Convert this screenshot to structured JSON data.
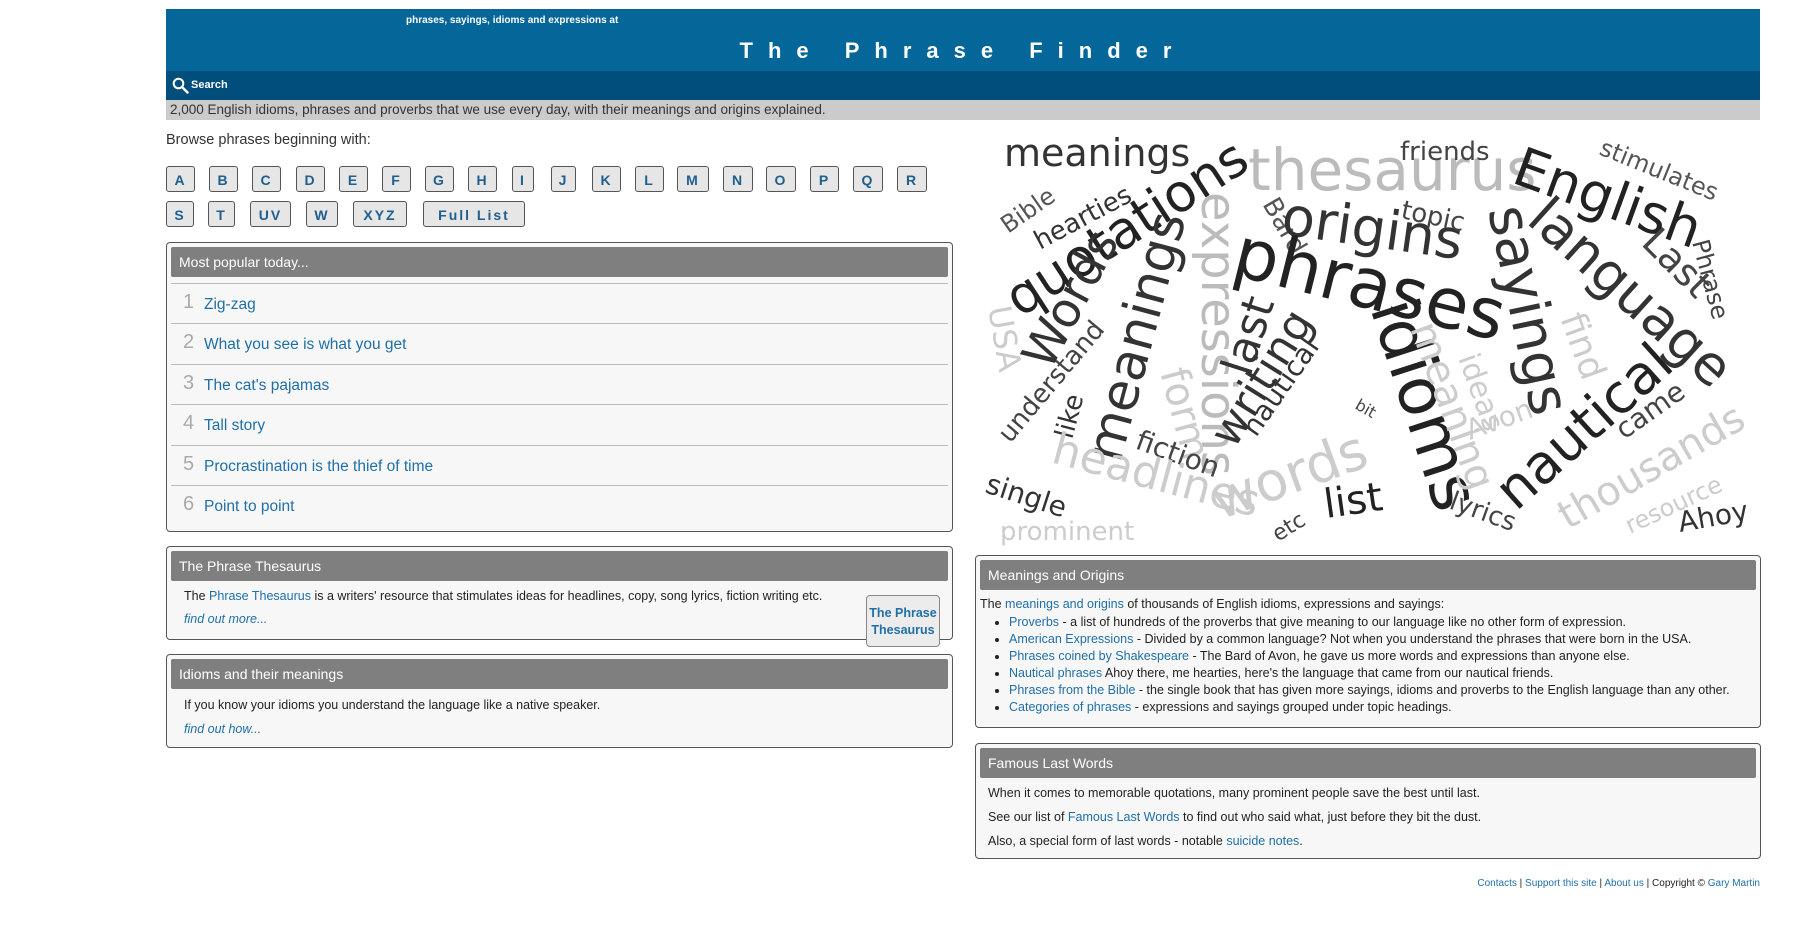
{
  "header": {
    "tagline": "phrases, sayings, idioms and expressions at",
    "title": "The Phrase Finder"
  },
  "search": {
    "label": "Search",
    "icon": "search-icon"
  },
  "intro": "2,000 English idioms, phrases and proverbs that we use every day, with their meanings and origins explained.",
  "browse": {
    "label": "Browse phrases beginning with:",
    "letters": [
      "A",
      "B",
      "C",
      "D",
      "E",
      "F",
      "G",
      "H",
      "I",
      "J",
      "K",
      "L",
      "M",
      "N",
      "O",
      "P",
      "Q",
      "R",
      "S",
      "T",
      "UV",
      "W",
      "XYZ",
      "Full List"
    ]
  },
  "popular": {
    "heading": "Most popular today...",
    "items": [
      {
        "num": "1",
        "label": "Zig-zag"
      },
      {
        "num": "2",
        "label": "What you see is what you get"
      },
      {
        "num": "3",
        "label": "The cat's pajamas"
      },
      {
        "num": "4",
        "label": "Tall story"
      },
      {
        "num": "5",
        "label": "Procrastination is the thief of time"
      },
      {
        "num": "6",
        "label": "Point to point"
      }
    ]
  },
  "thesaurus": {
    "heading": "The Phrase Thesaurus",
    "text_pre": "The",
    "link": "Phrase Thesaurus",
    "text_post": "is a writers' resource that stimulates ideas for headlines, copy, song lyrics, fiction writing etc.",
    "more": "find out more...",
    "button_line1": "The Phrase",
    "button_line2": "Thesaurus"
  },
  "idioms": {
    "heading": "Idioms and their meanings",
    "text": "If you know your idioms you understand the language like a native speaker.",
    "more": "find out how..."
  },
  "wordcloud": {
    "words": [
      "meanings",
      "thesaurus",
      "friends",
      "stimulates",
      "Bible",
      "hearties",
      "quotations",
      "expressions",
      "Bard",
      "origins",
      "topic",
      "English",
      "sayings",
      "language",
      "Last",
      "Phrase",
      "phrases",
      "Words",
      "meanings",
      "last",
      "idioms",
      "USA",
      "understand",
      "form",
      "writing",
      "nautical",
      "bit",
      "meaning",
      "ideas",
      "find",
      "like",
      "fiction",
      "Avon",
      "came",
      "headlines",
      "words",
      "list",
      "nautical",
      "thousands",
      "single",
      "etc",
      "lyrics",
      "resource",
      "Ahoy",
      "prominent"
    ]
  },
  "meanings": {
    "heading": "Meanings and Origins",
    "intro_pre": "The",
    "intro_link": "meanings and origins",
    "intro_post": "of thousands of English idioms, expressions and sayings:",
    "items": [
      {
        "link": "Proverbs",
        "text": " - a list of hundreds of the proverbs that give meaning to our language like no other form of expression."
      },
      {
        "link": "American Expressions",
        "text": " - Divided by a common language? Not when you understand the phrases that were born in the USA."
      },
      {
        "link": "Phrases coined by Shakespeare",
        "text": " - The Bard of Avon, he gave us more words and expressions than anyone else."
      },
      {
        "link": "Nautical phrases",
        "text": " Ahoy there, me hearties, here's the language that came from our nautical friends."
      },
      {
        "link": "Phrases from the Bible",
        "text": " - the single book that has given more sayings, idioms and proverbs to the English language than any other."
      },
      {
        "link": "Categories of phrases",
        "text": " - expressions and sayings grouped under topic headings."
      }
    ]
  },
  "famous": {
    "heading": "Famous Last Words",
    "line1": "When it comes to memorable quotations, many prominent people save the best until last.",
    "line2_pre": "See our list of",
    "line2_link": "Famous Last Words",
    "line2_post": "to find out who said what, just before they bit the dust.",
    "line3_pre": "Also, a special form of last words - notable",
    "line3_link": "suicide notes",
    "line3_post": "."
  },
  "footer": {
    "contacts": "Contacts",
    "support": "Support this site",
    "about": "About us",
    "copyright": "Copyright ©",
    "author": "Gary Martin",
    "sep": "|"
  },
  "colors": {
    "header_bg": "#056699",
    "searchbar_bg": "#014d7b",
    "panel_head_bg": "#7f7f7f",
    "link": "#1f6fa8"
  }
}
